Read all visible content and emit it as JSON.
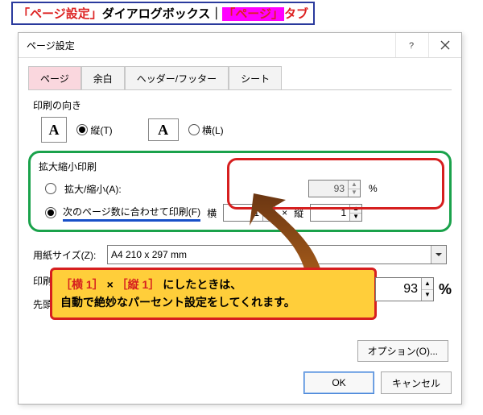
{
  "caption": {
    "pre": "「ページ設定」",
    "mid": "ダイアログボックス｜",
    "hilite": "「ページ」",
    "post": "タブ"
  },
  "dialog": {
    "title": "ページ設定"
  },
  "tabs": {
    "t0": "ページ",
    "t1": "余白",
    "t2": "ヘッダー/フッター",
    "t3": "シート"
  },
  "orientation": {
    "group_label": "印刷の向き",
    "portrait_glyph": "A",
    "portrait_label": "縦(T)",
    "landscape_glyph": "A",
    "landscape_label": "横(L)"
  },
  "scaling": {
    "group_label": "拡大縮小印刷",
    "adjust_label": "拡大/縮小(A):",
    "adjust_value": "93",
    "adjust_pct": "%",
    "fit_label": "次のページ数に合わせて印刷(F)",
    "fit_wide_label": "横",
    "fit_wide_value": "1",
    "fit_sep": "×",
    "fit_tall_label": "縦",
    "fit_tall_value": "1"
  },
  "paper": {
    "label": "用紙サイズ(Z):",
    "value": "A4 210 x 297 mm"
  },
  "quality": {
    "label": "印刷品質("
  },
  "firstpage": {
    "label": "先頭ペー"
  },
  "options_button": "オプション(O)...",
  "buttons": {
    "ok": "OK",
    "cancel": "キャンセル"
  },
  "callout": {
    "yoko": "［横 1］",
    "x": "×",
    "tate": "［縦 1］",
    "line1_tail": "にしたときは、",
    "line2": "自動で絶妙なパーセント設定をしてくれます。"
  },
  "result_spinner": "93",
  "result_pct": "%"
}
